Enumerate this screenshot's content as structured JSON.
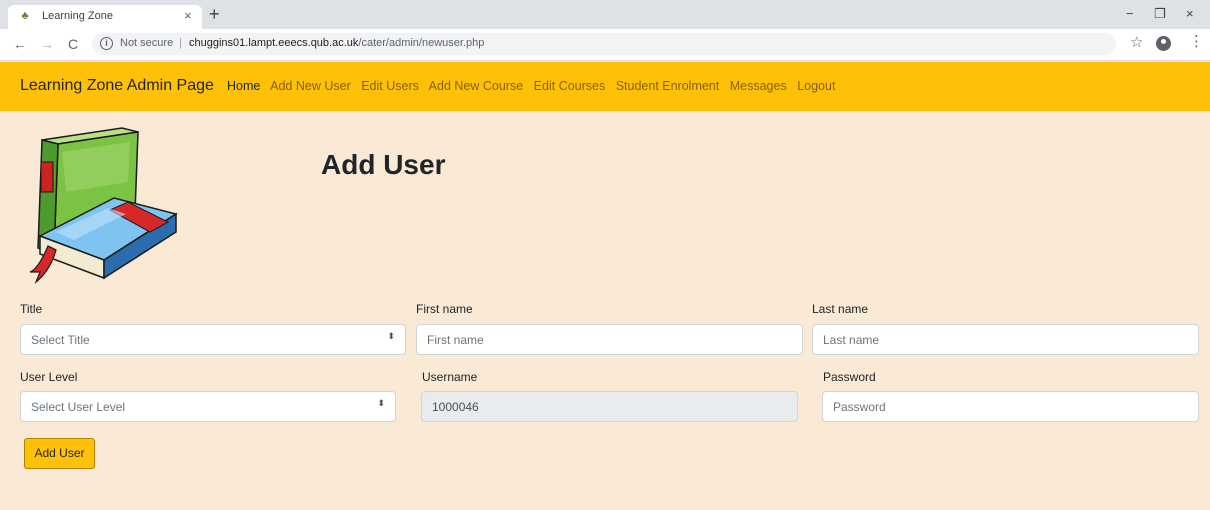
{
  "browser": {
    "tab_title": "Learning Zone",
    "tab_close": "×",
    "new_tab": "+",
    "window_controls": {
      "minimize": "−",
      "maximize": "❐",
      "close": "×"
    },
    "nav": {
      "back": "←",
      "forward": "→",
      "reload": "C"
    },
    "security_label": "Not secure",
    "separator": "|",
    "url_host": "chuggins01.lampt.eeecs.qub.ac.uk",
    "url_path": "/cater/admin/newuser.php",
    "icons": {
      "star": "☆",
      "menu": "⋮",
      "info": "i",
      "favicon": "favicon-icon",
      "account": "account-icon"
    }
  },
  "navbar": {
    "brand": "Learning Zone Admin Page",
    "links": [
      "Home",
      "Add New User",
      "Edit Users",
      "Add New Course",
      "Edit Courses",
      "Student Enrolment",
      "Messages",
      "Logout"
    ],
    "active_link": "Home",
    "color": "#ffc107"
  },
  "page": {
    "title": "Add User",
    "background": "#f9e9d5"
  },
  "form": {
    "title_label": "Title",
    "title_select": "Select Title",
    "first_name_label": "First name",
    "first_name_placeholder": "First name",
    "last_name_label": "Last name",
    "last_name_placeholder": "Last name",
    "user_level_label": "User Level",
    "user_level_select": "Select User Level",
    "username_label": "Username",
    "username_value": "1000046",
    "password_label": "Password",
    "password_placeholder": "Password",
    "submit_label": "Add User",
    "select_caret": "⬍"
  }
}
